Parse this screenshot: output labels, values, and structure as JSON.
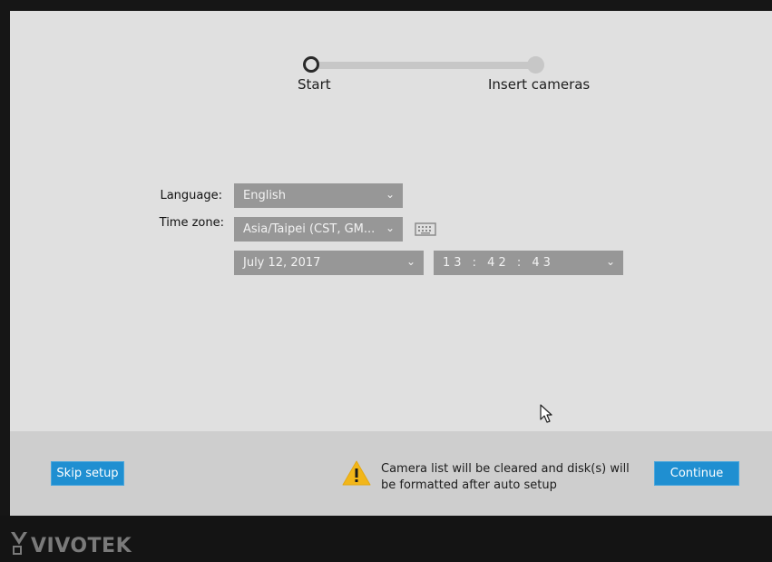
{
  "stepper": {
    "steps": [
      {
        "label": "Start",
        "state": "current"
      },
      {
        "label": "Insert cameras",
        "state": "upcoming"
      }
    ]
  },
  "form": {
    "language": {
      "label": "Language:",
      "value": "English"
    },
    "timezone": {
      "label": "Time zone:",
      "value": "Asia/Taipei (CST, GM..."
    },
    "date": {
      "value": "July 12, 2017"
    },
    "time": {
      "value": "13 : 42 : 43"
    }
  },
  "actions": {
    "skip_label": "Skip setup",
    "continue_label": "Continue",
    "warning_text": "Camera list will be cleared and disk(s) will be formatted after auto setup"
  },
  "footer": {
    "brand": "VIVOTEK"
  },
  "colors": {
    "accent": "#1f8fd1",
    "warning": "#f2b619",
    "field_bg": "#979797"
  },
  "icons": [
    "chevron-down-icon",
    "keyboard-icon",
    "warning-icon",
    "cursor-icon",
    "logo-icon"
  ]
}
